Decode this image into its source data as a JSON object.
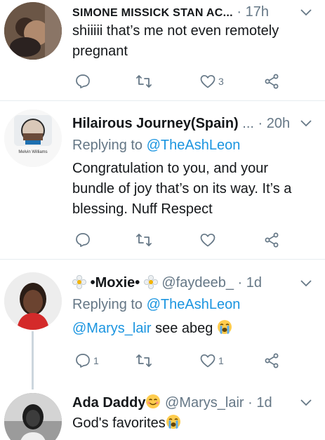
{
  "tweets": [
    {
      "name": "SIMONE MISSICK STAN AC...",
      "time": "· 17h",
      "text_lines": [
        "shiiiii that’s me not even remotely",
        "pregnant"
      ],
      "reply_count": "",
      "like_count": "3"
    },
    {
      "name": "Hilairous Journey(Spain)",
      "handle": "...",
      "time": "· 20h",
      "replying_prefix": "Replying to",
      "replying_to": "@TheAshLeon",
      "avatar_caption": "Melvin Williams",
      "text_lines": [
        "Congratulation to you,  and your",
        "bundle of joy that’s on its way. It’s  a",
        "blessing. Nuff Respect"
      ],
      "reply_count": "",
      "like_count": ""
    },
    {
      "name": "•Moxie•",
      "handle": "@faydeeb_",
      "time": "· 1d",
      "replying_prefix": "Replying to",
      "replying_to": "@TheAshLeon",
      "mention": "@Marys_lair",
      "text_after": " see abeg",
      "reply_count": "1",
      "like_count": "1"
    },
    {
      "name": "Ada Daddy",
      "handle": "@Marys_lair",
      "time": "· 1d",
      "text": "God's favorites"
    }
  ],
  "icons": {
    "reply": "reply-icon",
    "retweet": "retweet-icon",
    "like": "heart-icon",
    "share": "share-icon",
    "menu": "chevron-down-icon"
  },
  "colors": {
    "link": "#1b95e0",
    "muted": "#657786",
    "divider": "#e6ecf0"
  }
}
